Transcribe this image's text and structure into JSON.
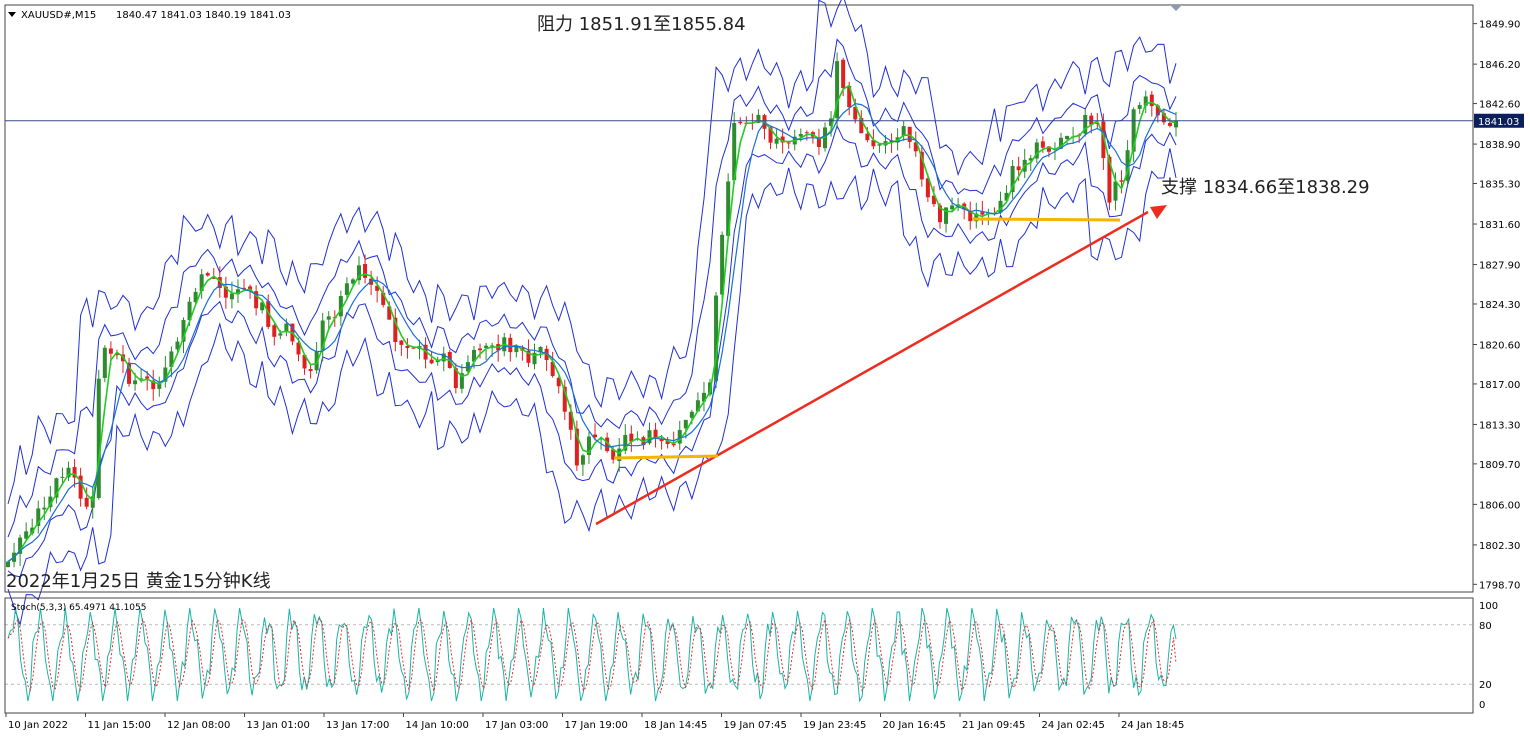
{
  "header": {
    "symbol": "XAUUSD#,M15",
    "ohlc": "1840.47 1841.03 1840.19 1841.03",
    "indicator": "Stoch(5,3,3) 65.4971 41.1055"
  },
  "annotations": {
    "resistance": "阻力 1851.91至1855.84",
    "support": "支撑 1834.66至1838.29",
    "caption": "2022年1月25日 黄金15分钟K线"
  },
  "current_price_label": "1841.03",
  "colors": {
    "candle_up": "#2e8b2e",
    "candle_down": "#e02020",
    "ma_fast": "#22cc22",
    "ma_slow": "#1a6ed8",
    "bands": "#1f2fd8",
    "trendline": "#ee2b1f",
    "support_line": "#f5b400",
    "stoch_main": "#1ab5a5",
    "stoch_signal": "#e03030"
  },
  "chart_data": [
    {
      "type": "candlestick",
      "symbol": "XAUUSD#",
      "timeframe": "M15",
      "y_ticks": [
        "1849.90",
        "1846.20",
        "1842.60",
        "1838.90",
        "1835.30",
        "1831.60",
        "1827.90",
        "1824.30",
        "1820.60",
        "1817.00",
        "1813.30",
        "1809.70",
        "1806.00",
        "1802.30",
        "1798.70"
      ],
      "ylim": [
        1798.0,
        1851.6
      ],
      "current_price": 1841.03,
      "x_ticks": [
        "10 Jan 2022",
        "11 Jan 15:00",
        "12 Jan 08:00",
        "13 Jan 01:00",
        "13 Jan 17:00",
        "14 Jan 10:00",
        "17 Jan 03:00",
        "17 Jan 19:00",
        "18 Jan 14:45",
        "19 Jan 07:45",
        "19 Jan 23:45",
        "20 Jan 16:45",
        "21 Jan 09:45",
        "24 Jan 02:45",
        "24 Jan 18:45"
      ],
      "close_path": [
        [
          0,
          1800.5
        ],
        [
          3,
          1803.5
        ],
        [
          6,
          1806.0
        ],
        [
          8,
          1808.5
        ],
        [
          10,
          1809.0
        ],
        [
          12,
          1807.0
        ],
        [
          13,
          1805.5
        ],
        [
          14,
          1806.5
        ],
        [
          15,
          1818.0
        ],
        [
          16,
          1820.5
        ],
        [
          18,
          1819.5
        ],
        [
          20,
          1817.5
        ],
        [
          22,
          1818.0
        ],
        [
          24,
          1817.0
        ],
        [
          26,
          1818.0
        ],
        [
          28,
          1821.0
        ],
        [
          30,
          1824.0
        ],
        [
          32,
          1827.0
        ],
        [
          34,
          1826.5
        ],
        [
          36,
          1825.0
        ],
        [
          38,
          1826.0
        ],
        [
          40,
          1825.0
        ],
        [
          42,
          1824.0
        ],
        [
          44,
          1821.5
        ],
        [
          46,
          1822.0
        ],
        [
          48,
          1819.5
        ],
        [
          50,
          1818.5
        ],
        [
          52,
          1822.5
        ],
        [
          54,
          1823.5
        ],
        [
          56,
          1826.5
        ],
        [
          58,
          1827.5
        ],
        [
          60,
          1826.0
        ],
        [
          62,
          1824.0
        ],
        [
          64,
          1821.0
        ],
        [
          66,
          1820.5
        ],
        [
          68,
          1820.0
        ],
        [
          70,
          1818.5
        ],
        [
          72,
          1819.5
        ],
        [
          74,
          1817.0
        ],
        [
          76,
          1819.0
        ],
        [
          78,
          1820.5
        ],
        [
          80,
          1820.0
        ],
        [
          82,
          1821.0
        ],
        [
          84,
          1820.0
        ],
        [
          86,
          1819.0
        ],
        [
          88,
          1820.0
        ],
        [
          90,
          1818.0
        ],
        [
          92,
          1815.0
        ],
        [
          94,
          1810.0
        ],
        [
          96,
          1812.0
        ],
        [
          98,
          1812.5
        ],
        [
          100,
          1809.5
        ],
        [
          102,
          1812.5
        ],
        [
          104,
          1811.5
        ],
        [
          106,
          1812.5
        ],
        [
          108,
          1811.5
        ],
        [
          110,
          1811.0
        ],
        [
          112,
          1813.5
        ],
        [
          114,
          1816.0
        ],
        [
          116,
          1817.5
        ],
        [
          117,
          1825.0
        ],
        [
          118,
          1831.0
        ],
        [
          119,
          1836.0
        ],
        [
          120,
          1840.5
        ],
        [
          122,
          1841.0
        ],
        [
          124,
          1841.5
        ],
        [
          126,
          1839.5
        ],
        [
          128,
          1839.0
        ],
        [
          130,
          1840.0
        ],
        [
          132,
          1840.0
        ],
        [
          134,
          1839.0
        ],
        [
          136,
          1841.5
        ],
        [
          137,
          1846.5
        ],
        [
          138,
          1844.5
        ],
        [
          139,
          1842.0
        ],
        [
          140,
          1841.0
        ],
        [
          142,
          1839.5
        ],
        [
          144,
          1839.0
        ],
        [
          146,
          1839.5
        ],
        [
          148,
          1840.5
        ],
        [
          150,
          1838.0
        ],
        [
          152,
          1834.5
        ],
        [
          154,
          1832.0
        ],
        [
          156,
          1833.5
        ],
        [
          158,
          1832.5
        ],
        [
          160,
          1832.0
        ],
        [
          162,
          1832.5
        ],
        [
          164,
          1833.5
        ],
        [
          166,
          1836.5
        ],
        [
          168,
          1837.0
        ],
        [
          170,
          1838.5
        ],
        [
          172,
          1838.5
        ],
        [
          174,
          1839.5
        ],
        [
          176,
          1839.0
        ],
        [
          178,
          1841.5
        ],
        [
          180,
          1840.5
        ],
        [
          182,
          1834.0
        ],
        [
          184,
          1836.0
        ],
        [
          186,
          1841.5
        ],
        [
          188,
          1843.0
        ],
        [
          190,
          1842.0
        ],
        [
          192,
          1840.5
        ],
        [
          193,
          1841.0
        ]
      ]
    },
    {
      "type": "line",
      "name": "Stoch(5,3,3)",
      "ylim": [
        0,
        100
      ],
      "y_ticks": [
        "100",
        "80",
        "20",
        "0"
      ],
      "levels": [
        20,
        80
      ],
      "main_last": 65.4971,
      "signal_last": 41.1055
    }
  ]
}
